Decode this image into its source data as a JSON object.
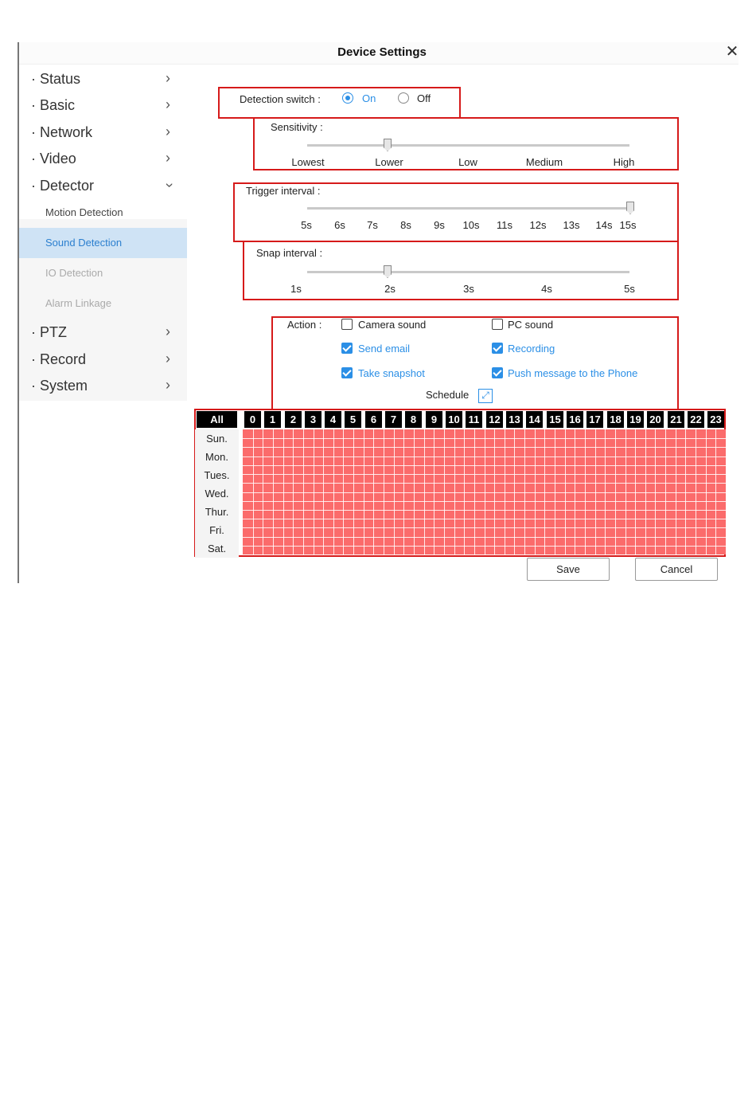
{
  "window": {
    "title": "Device Settings"
  },
  "sidebar": {
    "items": [
      {
        "label": "Status"
      },
      {
        "label": "Basic"
      },
      {
        "label": "Network"
      },
      {
        "label": "Video"
      },
      {
        "label": "Detector"
      },
      {
        "label": "PTZ"
      },
      {
        "label": "Record"
      },
      {
        "label": "System"
      }
    ],
    "sub_items": [
      {
        "label": "Motion Detection"
      },
      {
        "label": "Sound Detection"
      },
      {
        "label": "IO Detection"
      },
      {
        "label": "Alarm Linkage"
      }
    ]
  },
  "detection": {
    "label": "Detection switch :",
    "on_label": "On",
    "off_label": "Off",
    "selected": "On"
  },
  "sensitivity": {
    "label": "Sensitivity :",
    "ticks": [
      "Lowest",
      "Lower",
      "Low",
      "Medium",
      "High"
    ],
    "value": "Lower"
  },
  "trigger": {
    "label": "Trigger interval :",
    "ticks": [
      "5s",
      "6s",
      "7s",
      "8s",
      "9s",
      "10s",
      "11s",
      "12s",
      "13s",
      "14s",
      "15s"
    ],
    "value": "15s"
  },
  "snap": {
    "label": "Snap interval :",
    "ticks": [
      "1s",
      "2s",
      "3s",
      "4s",
      "5s"
    ],
    "value": "2s"
  },
  "action": {
    "label": "Action :",
    "camera_sound": "Camera sound",
    "pc_sound": "PC sound",
    "send_email": "Send email",
    "recording": "Recording",
    "take_snapshot": "Take snapshot",
    "push_message": "Push message to the Phone",
    "schedule": "Schedule"
  },
  "schedule": {
    "all_label": "All",
    "hours": [
      "0",
      "1",
      "2",
      "3",
      "4",
      "5",
      "6",
      "7",
      "8",
      "9",
      "10",
      "11",
      "12",
      "13",
      "14",
      "15",
      "16",
      "17",
      "18",
      "19",
      "20",
      "21",
      "22",
      "23"
    ],
    "days": [
      "Sun.",
      "Mon.",
      "Tues.",
      "Wed.",
      "Thur.",
      "Fri.",
      "Sat."
    ],
    "cell_color": "#fb6b6b"
  },
  "buttons": {
    "save": "Save",
    "cancel": "Cancel"
  },
  "colors": {
    "accent": "#2b8fe6",
    "highlight_box": "#d61a1a"
  }
}
